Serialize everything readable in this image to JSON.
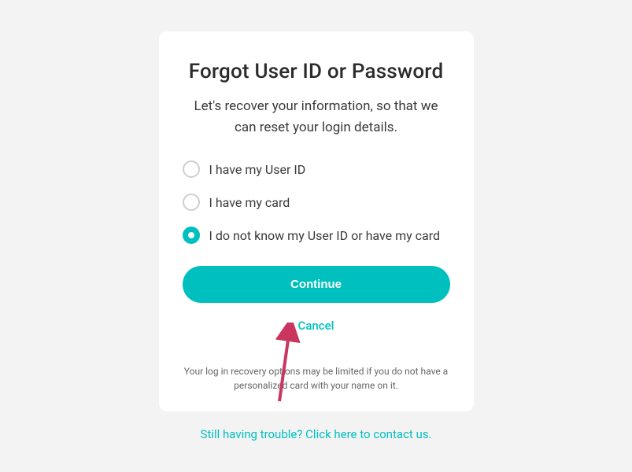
{
  "title": "Forgot User ID or Password",
  "subtitle": "Let's recover your information, so that we can reset your login details.",
  "options": [
    {
      "label": "I have my User ID",
      "selected": false
    },
    {
      "label": "I have my card",
      "selected": false
    },
    {
      "label": "I do not know my User ID or have my card",
      "selected": true
    }
  ],
  "continue_label": "Continue",
  "cancel_label": "Cancel",
  "note": "Your log in recovery options may be limited if you do not have a personalized card with your name on it.",
  "footer_link": "Still having trouble? Click here to contact us.",
  "colors": {
    "accent": "#00bfbf",
    "arrow": "#c9355f"
  }
}
